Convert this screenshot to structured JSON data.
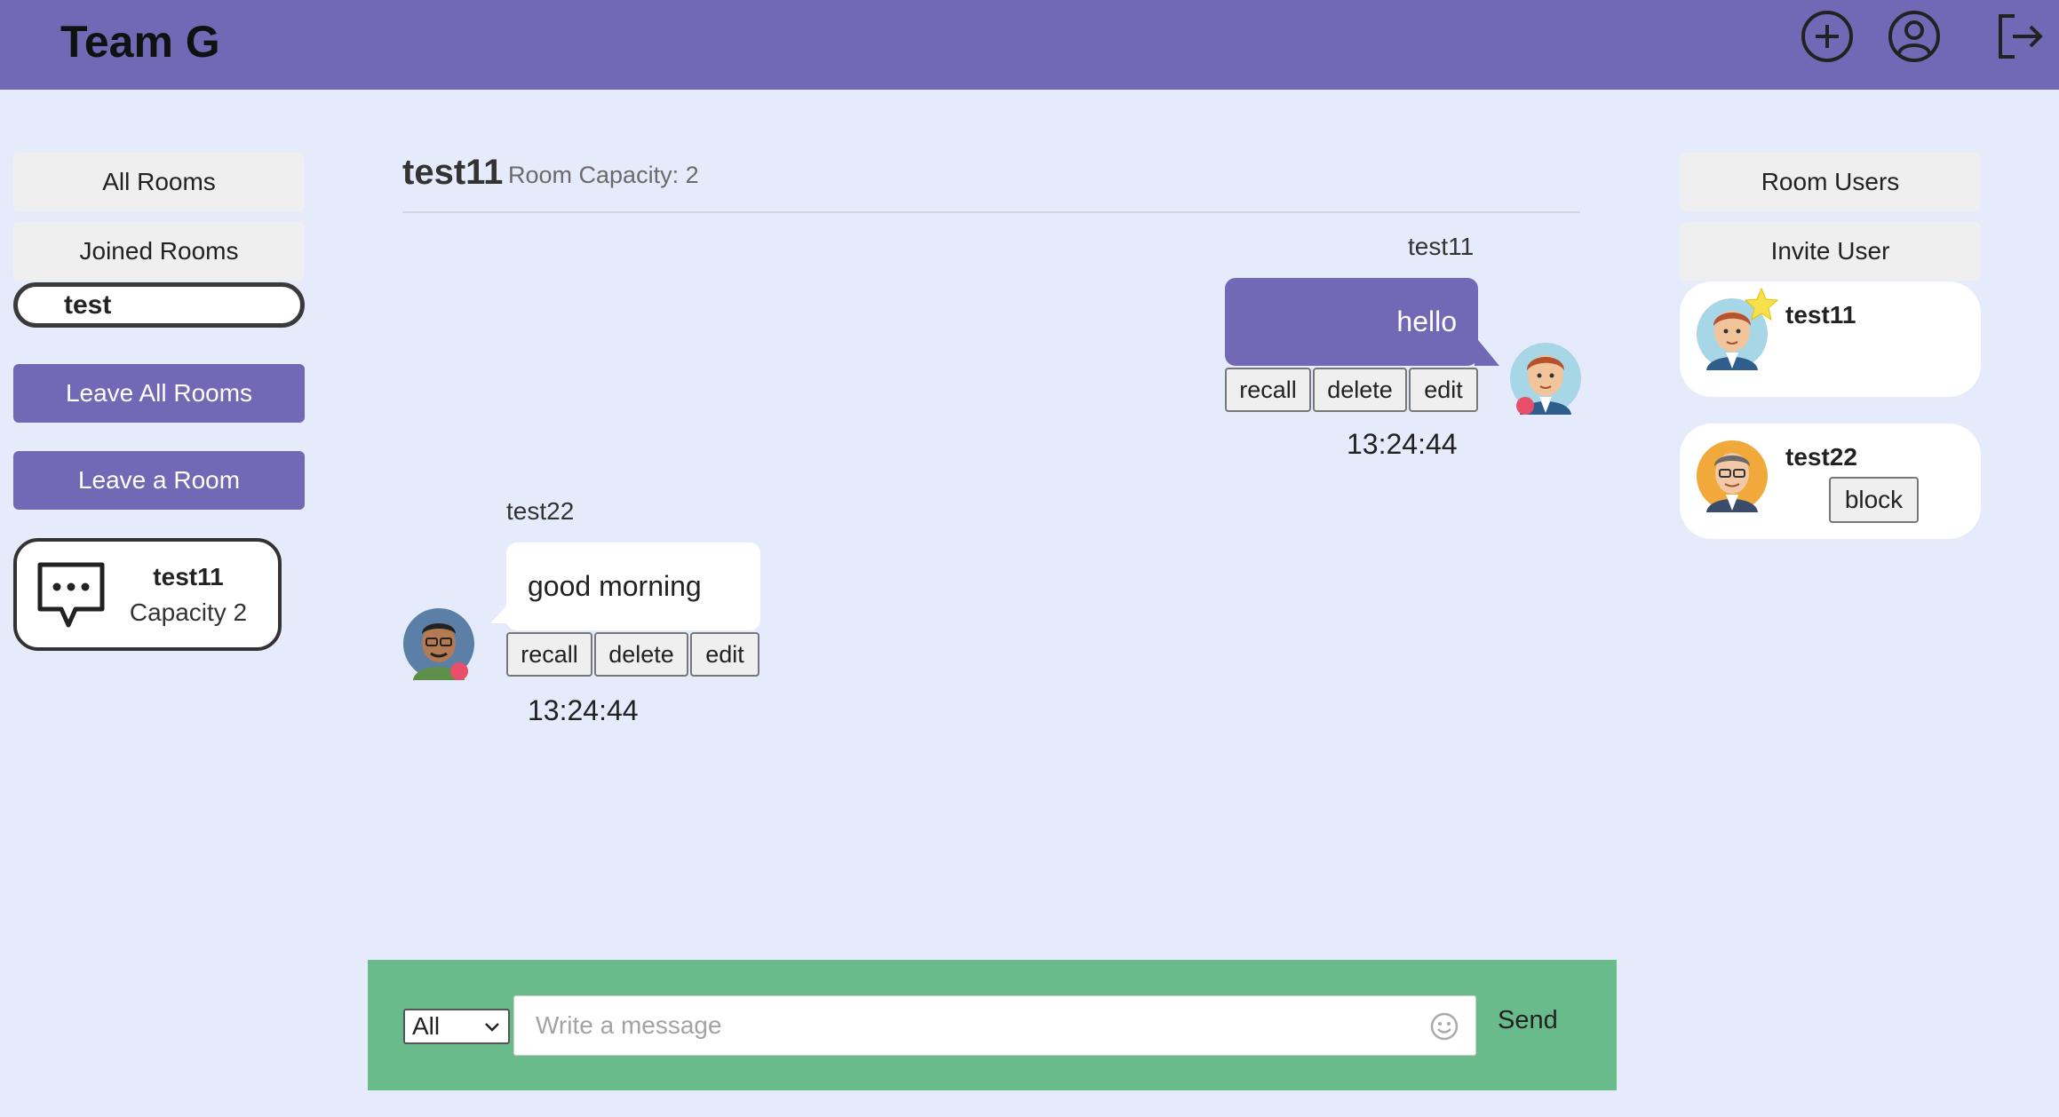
{
  "header": {
    "brand": "Team G",
    "icons": [
      "add-circle-icon",
      "user-profile-icon",
      "logout-icon"
    ],
    "color": "#7169b6"
  },
  "sidebar": {
    "all_rooms": "All Rooms",
    "joined_rooms": "Joined Rooms",
    "joined_room_item": "test",
    "leave_all": "Leave All Rooms",
    "leave_one": "Leave a Room",
    "room_card": {
      "name": "test11",
      "capacity": "Capacity 2",
      "icon": "chat-bubble-icon"
    }
  },
  "chat": {
    "room_name": "test11",
    "capacity_label": "Room Capacity: 2",
    "messages": [
      {
        "sender": "test11",
        "text": "hello",
        "time": "13:24:44",
        "own": true,
        "actions": [
          "recall",
          "delete",
          "edit"
        ]
      },
      {
        "sender": "test22",
        "text": "good morning",
        "time": "13:24:44",
        "own": false,
        "actions": [
          "recall",
          "delete",
          "edit"
        ]
      }
    ]
  },
  "composer": {
    "recipient": "All",
    "placeholder": "Write a message",
    "send_label": "Send",
    "background": "#6abb8c"
  },
  "right_panel": {
    "room_users": "Room Users",
    "invite_user": "Invite User",
    "users": [
      {
        "name": "test11",
        "owner": true
      },
      {
        "name": "test22",
        "owner": false,
        "action": "block"
      }
    ]
  },
  "colors": {
    "accent": "#7169b6",
    "background": "#e5ebfb",
    "status": "#e94f6b"
  }
}
